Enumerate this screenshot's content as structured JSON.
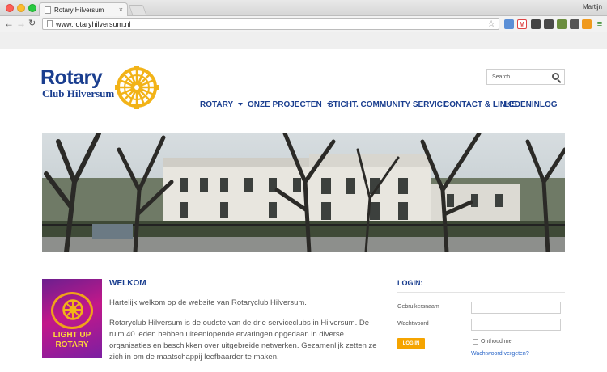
{
  "browser": {
    "tab_title": "Rotary Hilversum",
    "tab_close": "×",
    "user": "Martijn",
    "url": "www.rotaryhilversum.nl",
    "star": "☆"
  },
  "site": {
    "logo_word": "Rotary",
    "logo_sub": "Club Hilversum",
    "search_placeholder": "Search...",
    "menu": [
      {
        "label": "ROTARY"
      },
      {
        "label": "ONZE PROJECTEN"
      },
      {
        "label": "STICHT. COMMUNITY SERVICE"
      },
      {
        "label": "CONTACT & LINKS"
      },
      {
        "label": "LEDENINLOG"
      }
    ],
    "poster": {
      "line1": "LIGHT UP",
      "line2": "ROTARY"
    },
    "welcome": {
      "heading": "WELKOM",
      "p1": "Hartelijk welkom op de website van Rotaryclub Hilversum.",
      "p2": "Rotaryclub Hilversum is de oudste van de drie serviceclubs in Hilversum. De ruim 40 leden hebben uiteenlopende ervaringen opgedaan in diverse organisaties en beschikken over uitgebreide netwerken. Gezamenlijk zetten ze zich in om de maatschappij leefbaarder te maken."
    },
    "login": {
      "heading": "LOGIN:",
      "username_label": "Gebruikersnaam",
      "password_label": "Wachtwoord",
      "button": "LOG IN",
      "remember": "Onthoud me",
      "forgot": "Wachtwoord vergeten?"
    }
  },
  "colors": {
    "brand": "#1a3e8f",
    "accent": "#f5a400",
    "link": "#2a66c8"
  }
}
